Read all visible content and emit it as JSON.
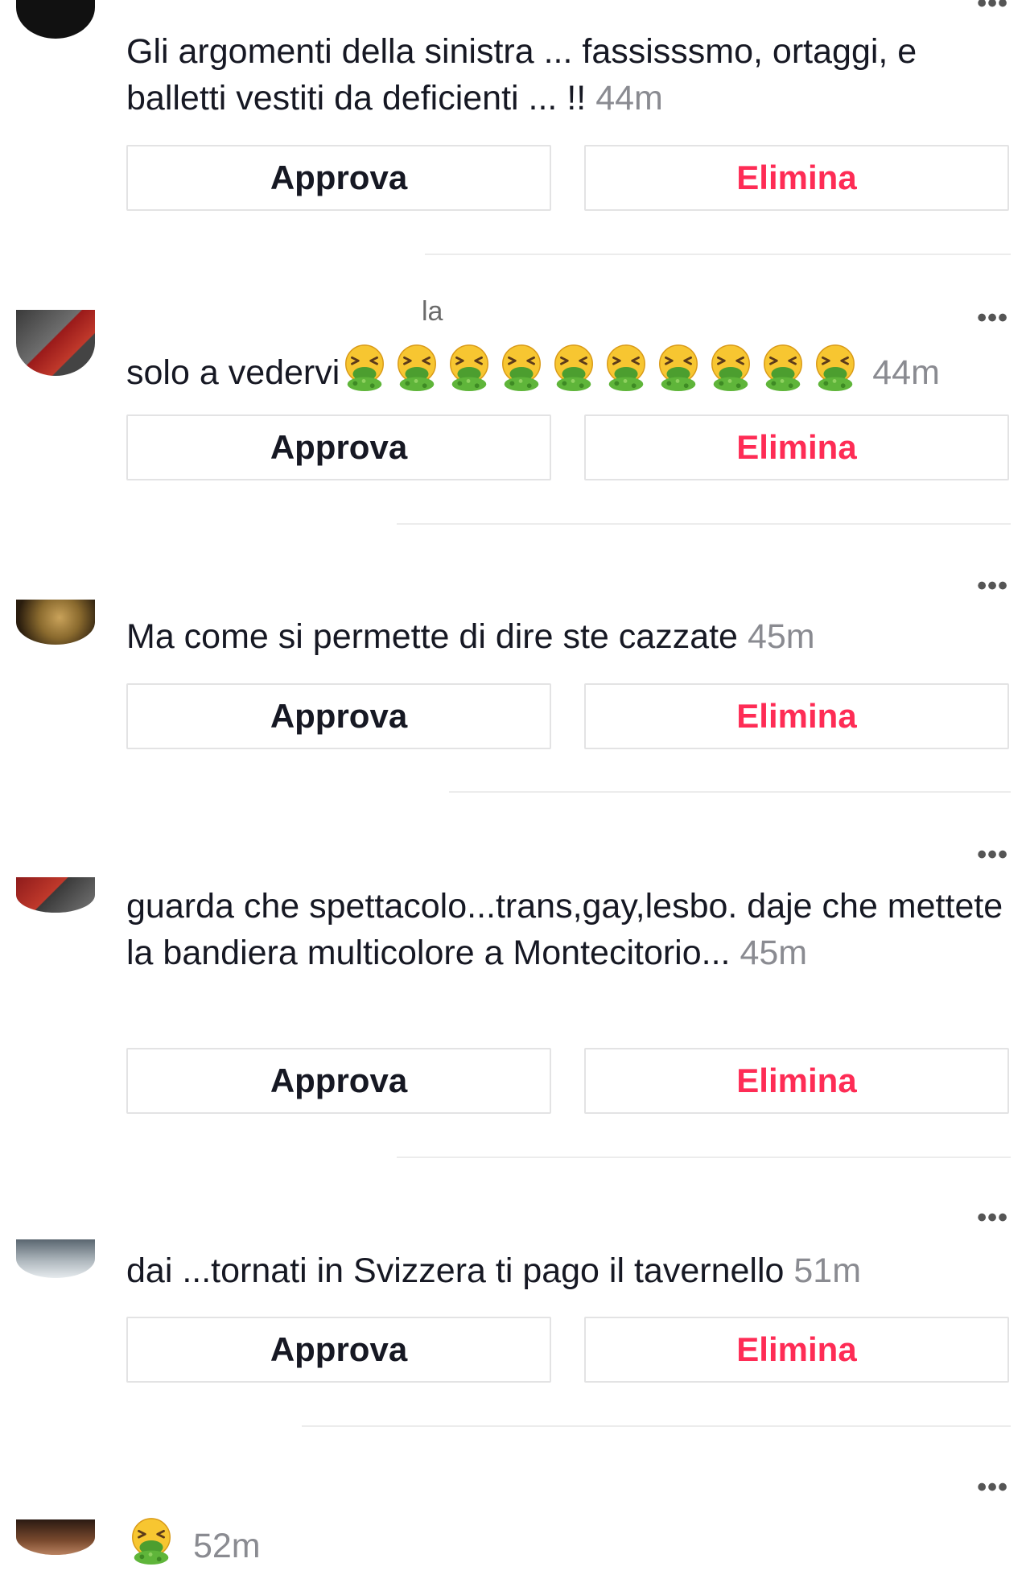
{
  "ui": {
    "more_glyph": "•••",
    "approve_label": "Approva",
    "delete_label": "Elimina",
    "colors": {
      "delete": "#fe2c55",
      "time": "#8a8b91",
      "text": "#161823",
      "border": "#e3e3e4"
    }
  },
  "comments": [
    {
      "text": "Gli argomenti della sinistra ... fassisssmo, ortaggi, e balletti vestiti da deficienti ... !!",
      "time": "44m"
    },
    {
      "username_fragment": "la",
      "text": "solo a vedervi",
      "emoji": [
        "nauseated-vomit-emoji",
        "nauseated-vomit-emoji",
        "nauseated-vomit-emoji",
        "nauseated-vomit-emoji",
        "nauseated-vomit-emoji",
        "nauseated-vomit-emoji",
        "nauseated-vomit-emoji",
        "nauseated-vomit-emoji",
        "nauseated-vomit-emoji",
        "nauseated-vomit-emoji"
      ],
      "time": "44m"
    },
    {
      "text": "Ma come si permette di dire ste cazzate",
      "time": "45m"
    },
    {
      "text": "guarda che spettacolo...trans,gay,lesbo. daje che mettete la bandiera multicolore a Montecitorio...",
      "time": "45m"
    },
    {
      "text": "dai ...tornati in Svizzera ti pago il tavernello",
      "time": "51m"
    },
    {
      "text": "",
      "emoji": [
        "nauseated-vomit-emoji"
      ],
      "time": "52m"
    }
  ]
}
